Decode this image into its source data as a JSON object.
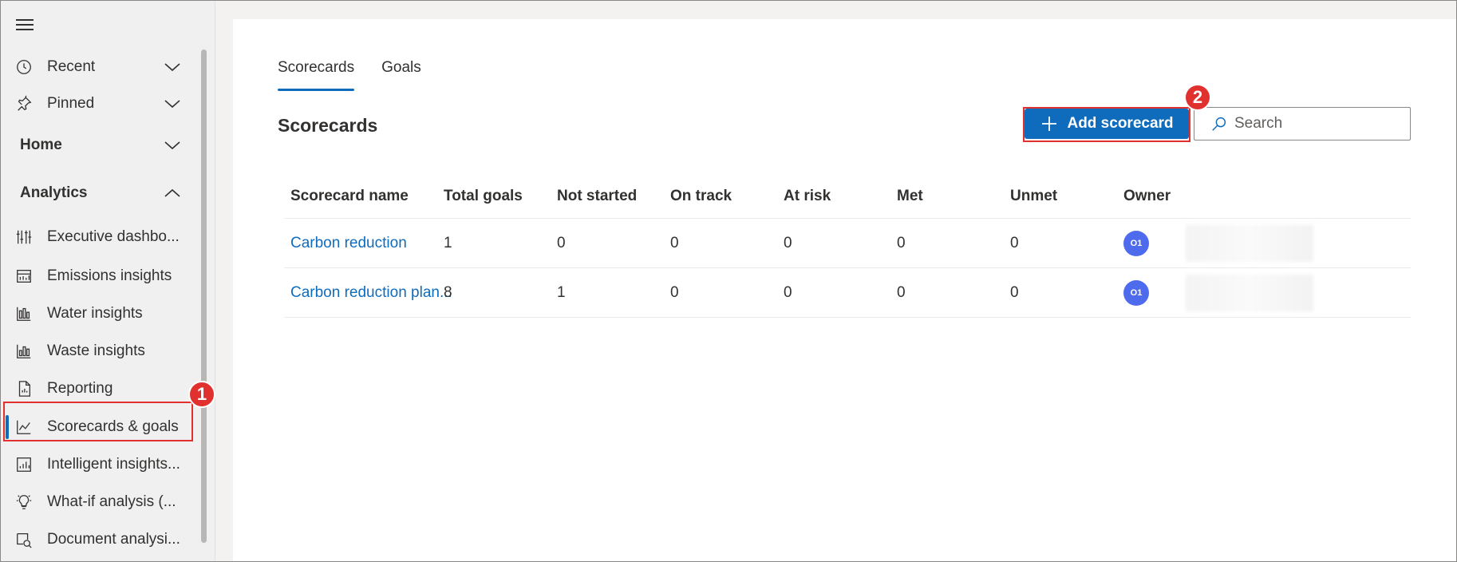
{
  "sidebar": {
    "items": [
      {
        "label": "Recent"
      },
      {
        "label": "Pinned"
      }
    ],
    "home": {
      "label": "Home"
    },
    "analytics": {
      "label": "Analytics",
      "items": [
        {
          "label": "Executive dashbo..."
        },
        {
          "label": "Emissions insights"
        },
        {
          "label": "Water insights"
        },
        {
          "label": "Waste insights"
        },
        {
          "label": "Reporting"
        },
        {
          "label": "Scorecards & goals"
        },
        {
          "label": "Intelligent insights..."
        },
        {
          "label": "What-if analysis (..."
        },
        {
          "label": "Document analysi..."
        }
      ]
    }
  },
  "main": {
    "tabs": [
      {
        "label": "Scorecards"
      },
      {
        "label": "Goals"
      }
    ],
    "title": "Scorecards",
    "add_button": "Add scorecard",
    "search": {
      "placeholder": "Search"
    },
    "table": {
      "headers": [
        "Scorecard name",
        "Total goals",
        "Not started",
        "On track",
        "At risk",
        "Met",
        "Unmet",
        "Owner"
      ],
      "rows": [
        {
          "name": "Carbon reduction",
          "total": "1",
          "not_started": "0",
          "on_track": "0",
          "at_risk": "0",
          "met": "0",
          "unmet": "0",
          "owner_initials": "O1"
        },
        {
          "name": "Carbon reduction plan...",
          "total": "8",
          "not_started": "1",
          "on_track": "0",
          "at_risk": "0",
          "met": "0",
          "unmet": "0",
          "owner_initials": "O1"
        }
      ]
    }
  },
  "callouts": {
    "one": "1",
    "two": "2"
  },
  "colors": {
    "accent": "#0f6cbd",
    "callout": "#e0312e",
    "avatar": "#4f6bed"
  }
}
